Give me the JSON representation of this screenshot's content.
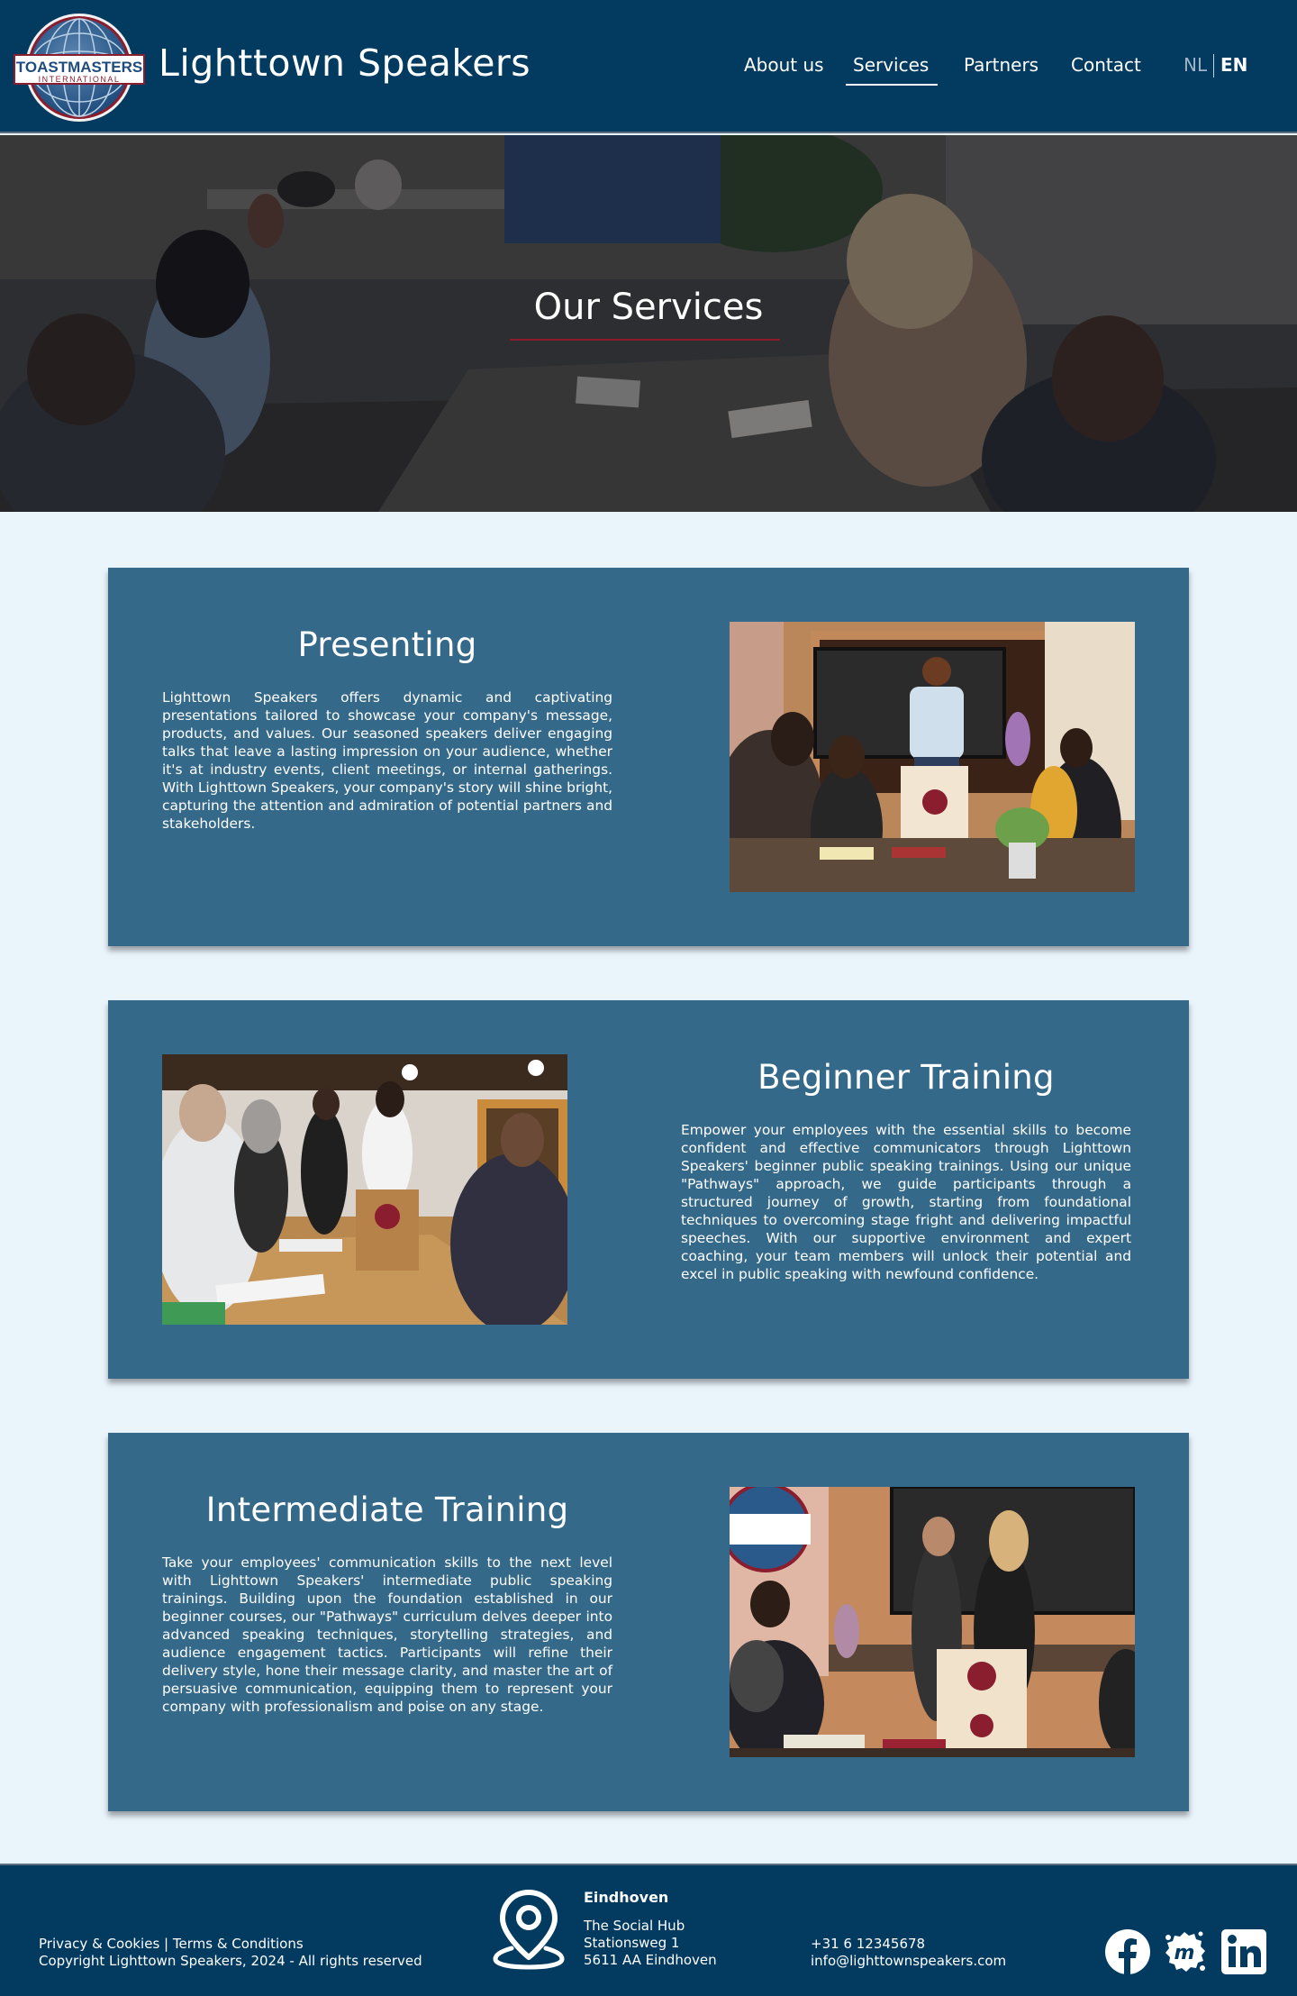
{
  "header": {
    "logo_line1": "TOASTMASTERS",
    "logo_line2": "INTERNATIONAL",
    "brand": "Lighttown Speakers",
    "nav": {
      "about": "About us",
      "services": "Services",
      "partners": "Partners",
      "contact": "Contact"
    },
    "lang": {
      "nl": "NL",
      "en": "EN",
      "active": "EN"
    }
  },
  "hero": {
    "title": "Our Services"
  },
  "services": [
    {
      "title": "Presenting",
      "text": "Lighttown Speakers offers dynamic and captivating presentations tailored to showcase your company's message, products, and values. Our seasoned speakers deliver engaging talks that leave a lasting impression on your audience, whether it's at industry events, client meetings, or internal gatherings. With Lighttown Speakers, your company's story will shine bright, capturing the attention and admiration of potential partners and stakeholders."
    },
    {
      "title": "Beginner Training",
      "text": "Empower your employees with the essential skills to become confident and effective communicators through Lighttown Speakers' beginner public speaking trainings. Using our unique \"Pathways\" approach, we guide participants through a structured journey of growth, starting from foundational techniques to overcoming stage fright and delivering impactful speeches. With our supportive environment and expert coaching, your team members will unlock their potential and excel in public speaking with newfound confidence."
    },
    {
      "title": "Intermediate Training",
      "text": "Take your employees' communication skills to the next level with Lighttown Speakers' intermediate public speaking trainings. Building upon the foundation established in our beginner courses, our \"Pathways\" curriculum delves deeper into advanced speaking techniques, storytelling strategies, and audience engagement tactics. Participants will refine their delivery style, hone their message clarity, and master the art of persuasive communication, equipping them to represent your company with professionalism and poise on any stage."
    }
  ],
  "footer": {
    "privacy": "Privacy & Cookies",
    "separator": " | ",
    "terms": "Terms & Conditions",
    "copyright": "Copyright Lighttown Speakers, 2024 - All rights reserved",
    "city": "Eindhoven",
    "address": [
      "The Social Hub",
      "Stationsweg 1",
      "5611 AA Eindhoven"
    ],
    "phone": "+31 6 12345678",
    "email": "info@lighttownspeakers.com",
    "social": [
      "facebook-icon",
      "meetup-icon",
      "linkedin-icon"
    ]
  },
  "colors": {
    "header_bg": "#023a60",
    "page_bg": "#e9f4fb",
    "card_bg": "#35698a",
    "accent": "#8c1c2c"
  }
}
